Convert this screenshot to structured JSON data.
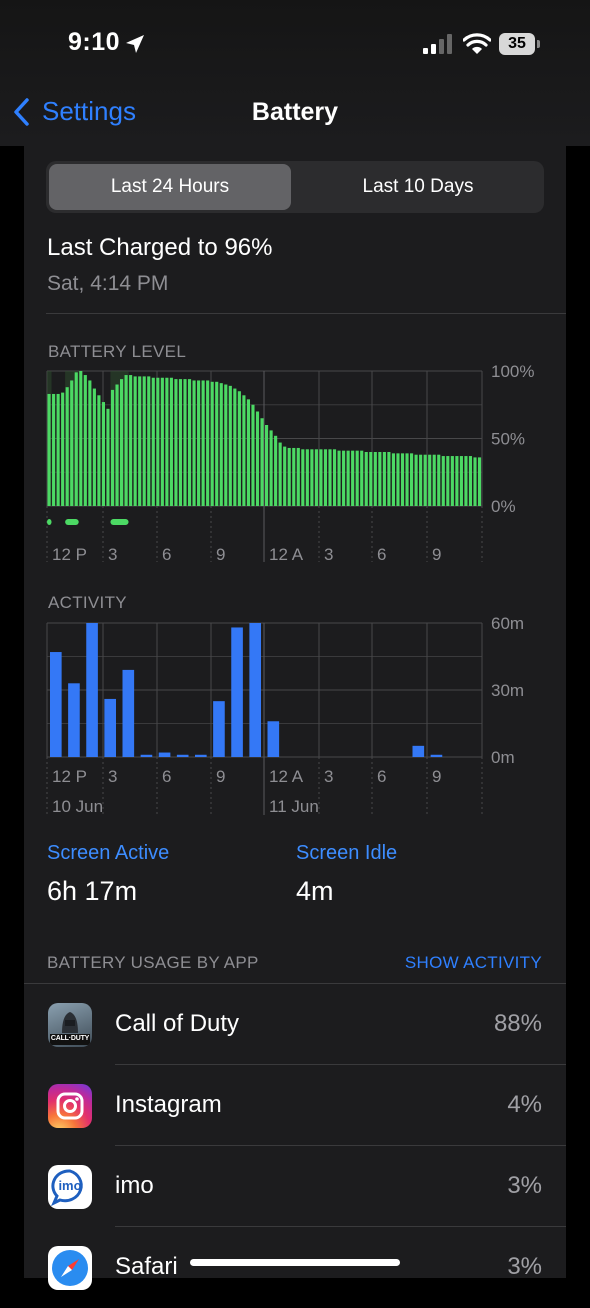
{
  "status_bar": {
    "time": "9:10",
    "battery_level": "35"
  },
  "nav": {
    "back_label": "Settings",
    "title": "Battery"
  },
  "segmented": {
    "selected": "Last 24 Hours",
    "other": "Last 10 Days"
  },
  "last_charged": {
    "title": "Last Charged to 96%",
    "subtitle": "Sat, 4:14 PM"
  },
  "battery_chart": {
    "label": "BATTERY LEVEL",
    "y_ticks": [
      "100%",
      "50%",
      "0%"
    ],
    "x_ticks": [
      "12 P",
      "3",
      "6",
      "9",
      "12 A",
      "3",
      "6",
      "9"
    ]
  },
  "activity_chart": {
    "label": "ACTIVITY",
    "y_ticks": [
      "60m",
      "30m",
      "0m"
    ],
    "x_ticks": [
      "12 P",
      "3",
      "6",
      "9",
      "12 A",
      "3",
      "6",
      "9"
    ],
    "dates": [
      "10 Jun",
      "11 Jun"
    ]
  },
  "chart_data": [
    {
      "type": "bar",
      "title": "BATTERY LEVEL",
      "unit": "%",
      "ylim": [
        0,
        100
      ],
      "x_start": "12 P",
      "bar_interval_minutes": 15,
      "values": [
        83,
        83,
        83,
        84,
        88,
        93,
        99,
        100,
        97,
        93,
        87,
        82,
        77,
        72,
        86,
        90,
        94,
        97,
        97,
        96,
        96,
        96,
        96,
        95,
        95,
        95,
        95,
        95,
        94,
        94,
        94,
        94,
        93,
        93,
        93,
        93,
        92,
        92,
        91,
        90,
        89,
        87,
        85,
        82,
        79,
        75,
        70,
        65,
        60,
        56,
        52,
        47,
        44,
        43,
        43,
        43,
        42,
        42,
        42,
        42,
        42,
        42,
        42,
        42,
        41,
        41,
        41,
        41,
        41,
        41,
        40,
        40,
        40,
        40,
        40,
        40,
        39,
        39,
        39,
        39,
        39,
        38,
        38,
        38,
        38,
        38,
        38,
        37,
        37,
        37,
        37,
        37,
        37,
        37,
        36,
        36
      ],
      "charging_segments": [
        [
          0,
          0
        ],
        [
          4,
          6
        ],
        [
          14,
          17
        ]
      ],
      "color": "#4cd964"
    },
    {
      "type": "bar",
      "title": "ACTIVITY",
      "unit": "minutes",
      "ylim": [
        0,
        60
      ],
      "categories": [
        "12 P",
        "1",
        "2",
        "3",
        "4",
        "5",
        "6",
        "7",
        "8",
        "9",
        "10",
        "11",
        "12 A",
        "1",
        "2",
        "3",
        "4",
        "5",
        "6",
        "7",
        "8",
        "9",
        "10",
        "11"
      ],
      "values": [
        47,
        33,
        60,
        26,
        39,
        1,
        2,
        1,
        1,
        25,
        58,
        60,
        16,
        0,
        0,
        0,
        0,
        0,
        0,
        0,
        5,
        1,
        0,
        0
      ],
      "color": "#3478f6"
    }
  ],
  "legend": {
    "screen_active_label": "Screen Active",
    "screen_active_value": "6h 17m",
    "screen_idle_label": "Screen Idle",
    "screen_idle_value": "4m"
  },
  "usage": {
    "header": "BATTERY USAGE BY APP",
    "action": "SHOW ACTIVITY",
    "apps": [
      {
        "name": "Call of Duty",
        "percent": "88%",
        "icon": "call-of-duty-icon",
        "icon_text": "CALL·DUTY"
      },
      {
        "name": "Instagram",
        "percent": "4%",
        "icon": "instagram-icon"
      },
      {
        "name": "imo",
        "percent": "3%",
        "icon": "imo-icon",
        "icon_text": "imo"
      },
      {
        "name": "Safari",
        "percent": "3%",
        "icon": "safari-icon"
      }
    ]
  },
  "colors": {
    "accent": "#2f80ff",
    "battery_green": "#4cd964",
    "activity_blue": "#3478f6"
  }
}
